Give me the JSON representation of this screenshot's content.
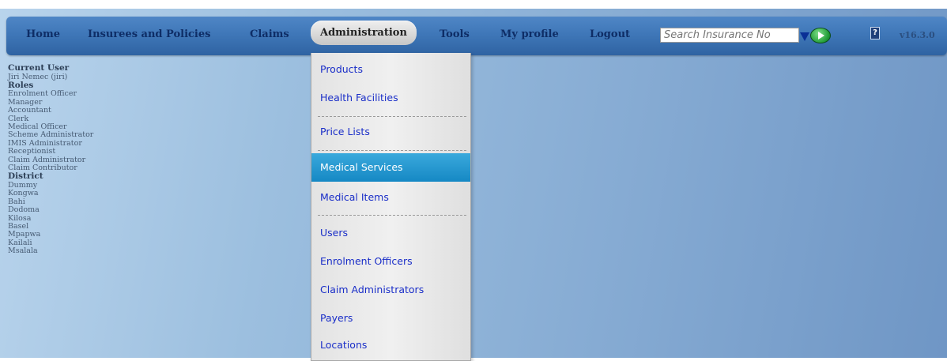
{
  "nav": {
    "items": [
      "Home",
      "Insurees and Policies",
      "Claims",
      "Administration",
      "Tools",
      "My profile",
      "Logout"
    ],
    "active": "Administration",
    "search_placeholder": "Search Insurance No",
    "version": "v16.3.0",
    "help_icon": "help-icon",
    "go_icon": "play-icon"
  },
  "user_panel": {
    "current_user_header": "Current User",
    "current_user": "Jiri Nemec (jiri)",
    "roles_header": "Roles",
    "roles": [
      "Enrolment Officer",
      "Manager",
      "Accountant",
      "Clerk",
      "Medical Officer",
      "Scheme Administrator",
      "IMIS Administrator",
      "Receptionist",
      "Claim Administrator",
      "Claim Contributor"
    ],
    "district_header": "District",
    "districts": [
      "Dummy",
      "Kongwa",
      "Bahi",
      "Dodoma",
      "Kilosa",
      "Basel",
      "Mpapwa",
      "Kailali",
      "Msalala"
    ]
  },
  "dropdown": {
    "items": [
      "Products",
      "Health Facilities",
      "Price Lists",
      "Medical Services",
      "Medical Items",
      "Users",
      "Enrolment Officers",
      "Claim Administrators",
      "Payers",
      "Locations"
    ],
    "highlighted": "Medical Services"
  },
  "colors": {
    "nav_bg": "#3f77b8",
    "nav_text": "#0e2d66",
    "menu_link": "#1a2ec8",
    "menu_highlight": "#1e96cf"
  }
}
